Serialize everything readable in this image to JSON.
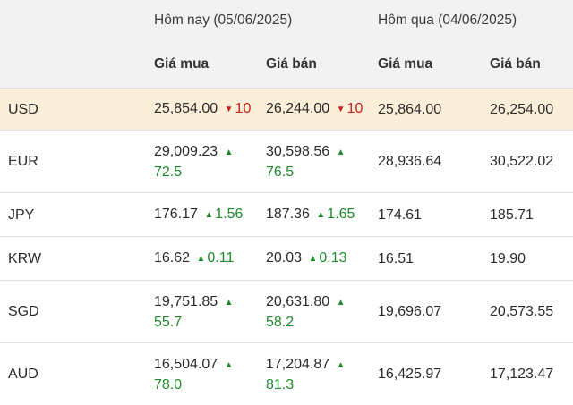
{
  "colors": {
    "up": "#1e8a2c",
    "down": "#c81e1e",
    "highlight_row": "#fcefd9",
    "header_bg": "#f2f2f2"
  },
  "header": {
    "today_label": "Hôm nay (05/06/2025)",
    "yesterday_label": "Hôm qua (04/06/2025)",
    "buy_label": "Giá mua",
    "sell_label": "Giá bán"
  },
  "rows": [
    {
      "code": "USD",
      "today_buy": "25,854.00",
      "today_buy_change": "10",
      "today_buy_dir": "down",
      "today_sell": "26,244.00",
      "today_sell_change": "10",
      "today_sell_dir": "down",
      "yesterday_buy": "25,864.00",
      "yesterday_sell": "26,254.00"
    },
    {
      "code": "EUR",
      "today_buy": "29,009.23",
      "today_buy_change": "72.5",
      "today_buy_dir": "up",
      "today_sell": "30,598.56",
      "today_sell_change": "76.5",
      "today_sell_dir": "up",
      "yesterday_buy": "28,936.64",
      "yesterday_sell": "30,522.02"
    },
    {
      "code": "JPY",
      "today_buy": "176.17",
      "today_buy_change": "1.56",
      "today_buy_dir": "up",
      "today_sell": "187.36",
      "today_sell_change": "1.65",
      "today_sell_dir": "up",
      "yesterday_buy": "174.61",
      "yesterday_sell": "185.71"
    },
    {
      "code": "KRW",
      "today_buy": "16.62",
      "today_buy_change": "0.11",
      "today_buy_dir": "up",
      "today_sell": "20.03",
      "today_sell_change": "0.13",
      "today_sell_dir": "up",
      "yesterday_buy": "16.51",
      "yesterday_sell": "19.90"
    },
    {
      "code": "SGD",
      "today_buy": "19,751.85",
      "today_buy_change": "55.7",
      "today_buy_dir": "up",
      "today_sell": "20,631.80",
      "today_sell_change": "58.2",
      "today_sell_dir": "up",
      "yesterday_buy": "19,696.07",
      "yesterday_sell": "20,573.55"
    },
    {
      "code": "AUD",
      "today_buy": "16,504.07",
      "today_buy_change": "78.0",
      "today_buy_dir": "up",
      "today_sell": "17,204.87",
      "today_sell_change": "81.3",
      "today_sell_dir": "up",
      "yesterday_buy": "16,425.97",
      "yesterday_sell": "17,123.47"
    }
  ]
}
